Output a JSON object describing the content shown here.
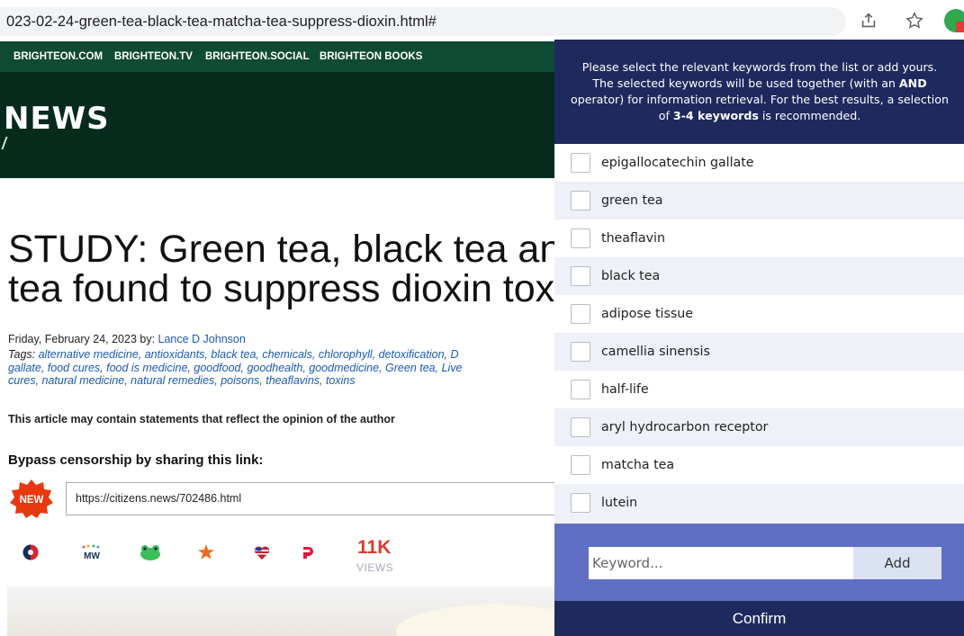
{
  "browser": {
    "url": "023-02-24-green-tea-black-tea-matcha-tea-suppress-dioxin.html#",
    "icons": [
      "share-icon",
      "star-icon",
      "extension-icon"
    ]
  },
  "site": {
    "nav": [
      "BRIGHTEON.COM",
      "BRIGHTEON.TV",
      "BRIGHTEON.SOCIAL",
      "BRIGHTEON BOOKS"
    ],
    "logo": "NEWS"
  },
  "article": {
    "headline_line1": "STUDY: Green tea, black tea and",
    "headline_line2": "tea found to suppress dioxin toxic",
    "date_prefix": "Friday, February 24, 2023 by: ",
    "author": "Lance D Johnson",
    "tags_label": "Tags:",
    "tags_line1": "alternative medicine, antioxidants, black tea, chemicals, chlorophyll, detoxification, D",
    "tags_line2": "gallate, food cures, food is medicine, goodfood, goodhealth, goodmedicine, Green tea, Live",
    "tags_line3": "cures, natural medicine, natural remedies, poisons, theaflavins, toxins",
    "opinion_note": "This article may contain statements that reflect the opinion of the author",
    "bypass_label": "Bypass censorship by sharing this link:",
    "new_badge": "NEW",
    "share_link": "https://citizens.news/702486.html",
    "views_count": "11K",
    "views_label": "VIEWS",
    "social_icons": [
      "brighteon-icon",
      "mewe-icon",
      "frog-icon",
      "gab-icon",
      "flag-heart-icon",
      "parler-icon"
    ]
  },
  "panel": {
    "instr_part1": "Please select the relevant keywords from the list or add yours. The selected keywords will be used together (with an ",
    "instr_and": "AND",
    "instr_part2": " operator) for information retrieval. For the best results, a selection of ",
    "instr_count": "3-4 keywords",
    "instr_part3": " is recommended.",
    "keywords": [
      {
        "label": "epigallocatechin gallate",
        "checked": false
      },
      {
        "label": "green tea",
        "checked": false
      },
      {
        "label": "theaflavin",
        "checked": false
      },
      {
        "label": "black tea",
        "checked": false
      },
      {
        "label": "adipose tissue",
        "checked": false
      },
      {
        "label": "camellia sinensis",
        "checked": false
      },
      {
        "label": "half-life",
        "checked": false
      },
      {
        "label": "aryl hydrocarbon receptor",
        "checked": false
      },
      {
        "label": "matcha tea",
        "checked": false
      },
      {
        "label": "lutein",
        "checked": false
      }
    ],
    "keyword_placeholder": "Keyword...",
    "add_label": "Add",
    "confirm_label": "Confirm"
  },
  "colors": {
    "panel_header": "#1e2a5e",
    "add_area": "#5e6fc4",
    "site_nav": "#0f4a33",
    "masthead": "#062b1d",
    "link": "#1a5ab8",
    "views": "#e23a2d"
  }
}
